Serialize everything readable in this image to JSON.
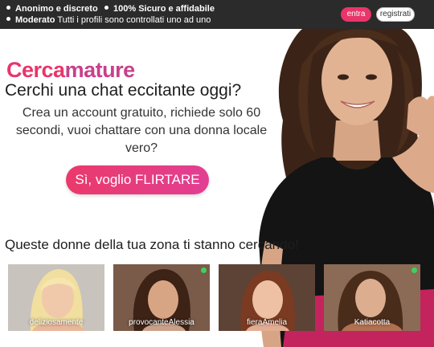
{
  "topbar": {
    "features": [
      {
        "bold": "Anonimo e discreto",
        "text": ""
      },
      {
        "bold": "100% Sicuro e affidabile",
        "text": ""
      },
      {
        "bold": "Moderato",
        "text": "Tutti i profili sono controllati uno ad uno"
      }
    ],
    "login_label": "entra",
    "register_label": "registrati"
  },
  "hero": {
    "logo_part1": "Cerca",
    "logo_part2": "mature",
    "headline": "Cerchi una chat eccitante oggi?",
    "subtitle": "Crea un account gratuito, richiede solo 60 secondi, vuoi chattare con una donna locale vero?",
    "cta_label": "Sì, voglio FLIRTARE"
  },
  "profiles_section": {
    "title": "Queste donne della tua zona ti stanno cercando!",
    "profiles": [
      {
        "name": "deliziosamente",
        "online": false
      },
      {
        "name": "provocanteAlessia",
        "online": true
      },
      {
        "name": "fieraAmelia",
        "online": false
      },
      {
        "name": "Katiacotta",
        "online": true
      }
    ]
  },
  "colors": {
    "accent": "#e8356a",
    "accent_secondary": "#c8408a",
    "topbar_bg": "#2b2b2b",
    "online": "#3fd15a"
  }
}
